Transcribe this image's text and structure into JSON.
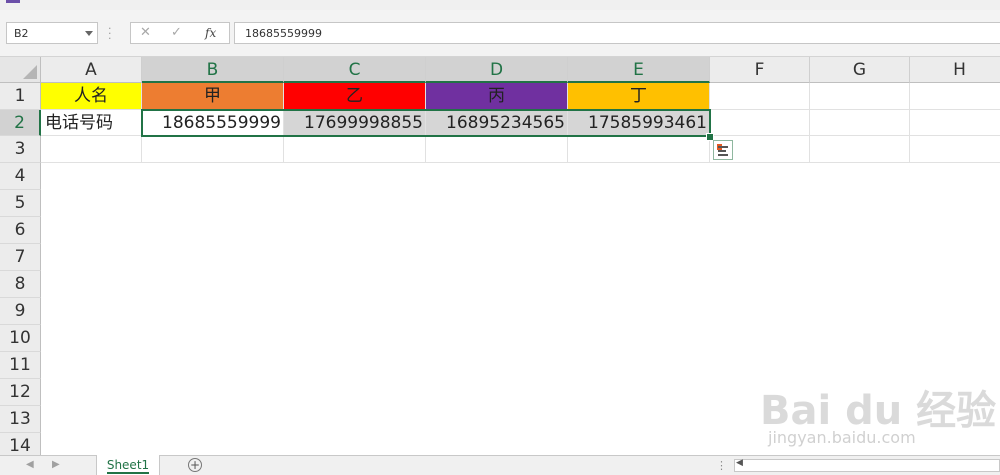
{
  "app": {
    "accent": "#217346"
  },
  "formula_bar": {
    "name_box": "B2",
    "cancel_icon": "x-icon",
    "enter_icon": "check-icon",
    "fx_label": "fx",
    "formula": "18685559999"
  },
  "columns": [
    "A",
    "B",
    "C",
    "D",
    "E",
    "F",
    "G",
    "H"
  ],
  "rows": [
    "1",
    "2",
    "3",
    "4",
    "5",
    "6",
    "7",
    "8",
    "9",
    "10",
    "11",
    "12",
    "13",
    "14"
  ],
  "cells": {
    "A1": {
      "value": "人名",
      "fill": "#ffff00"
    },
    "B1": {
      "value": "甲",
      "fill": "#ed7d31"
    },
    "C1": {
      "value": "乙",
      "fill": "#ff0000"
    },
    "D1": {
      "value": "丙",
      "fill": "#7030a0"
    },
    "E1": {
      "value": "丁",
      "fill": "#ffc000"
    },
    "A2": {
      "value": "电话号码"
    },
    "B2": {
      "value": "18685559999"
    },
    "C2": {
      "value": "17699998855"
    },
    "D2": {
      "value": "16895234565"
    },
    "E2": {
      "value": "17585993461"
    }
  },
  "selection": {
    "range": "B2:E2",
    "active_cell": "B2"
  },
  "quick_analysis": {
    "icon": "quick-analysis-icon"
  },
  "sheet_tabs": {
    "tabs": [
      "Sheet1"
    ],
    "active": "Sheet1",
    "add_label": "+"
  },
  "watermark": {
    "text": "Bai du 经验",
    "url": "jingyan.baidu.com"
  }
}
